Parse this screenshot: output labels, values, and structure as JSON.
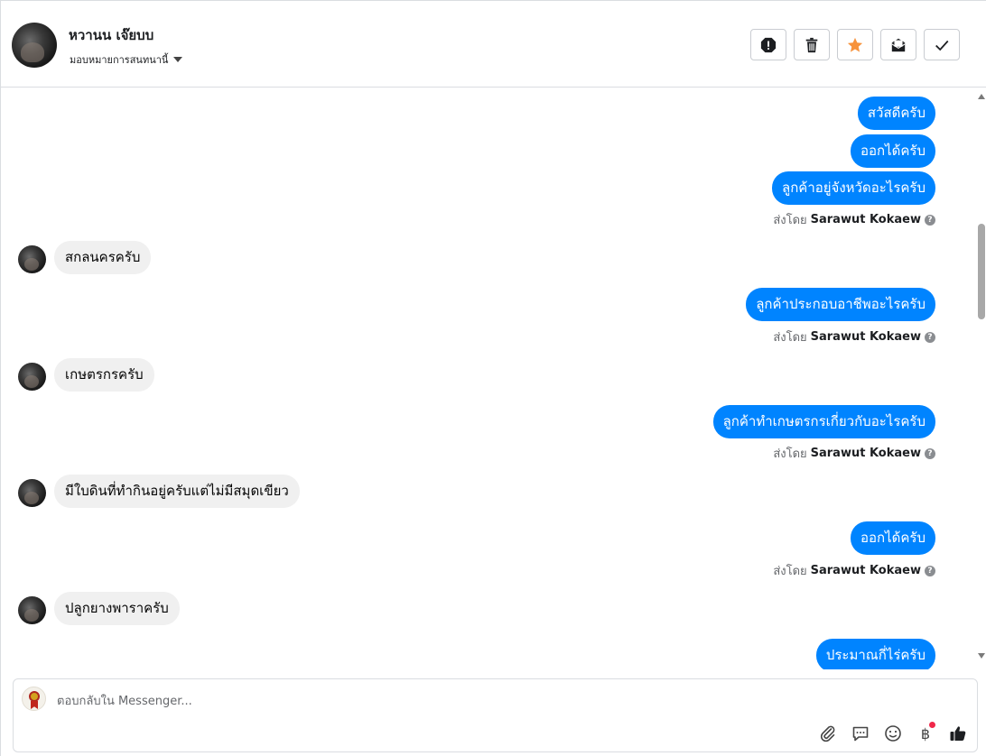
{
  "header": {
    "contact_name": "หวานน เจ๊ยบบ",
    "assign_label": "มอบหมายการสนทนานี้",
    "actions": [
      {
        "name": "report-button",
        "icon": "exclamation-circle-icon"
      },
      {
        "name": "delete-button",
        "icon": "trash-icon"
      },
      {
        "name": "star-button",
        "icon": "star-icon",
        "color": "#f7923a"
      },
      {
        "name": "mark-unread-button",
        "icon": "envelope-icon"
      },
      {
        "name": "mark-done-button",
        "icon": "check-icon"
      }
    ]
  },
  "messages": [
    {
      "dir": "out",
      "text": "สวัสดีครับ"
    },
    {
      "dir": "out",
      "text": "ออกได้ครับ"
    },
    {
      "dir": "out",
      "text": "ลูกค้าอยู่จังหวัดอะไรครับ"
    },
    {
      "dir": "sent_by",
      "prefix": "ส่งโดย",
      "name": "Sarawut Kokaew"
    },
    {
      "dir": "in",
      "text": "สกลนครครับ"
    },
    {
      "dir": "out",
      "text": "ลูกค้าประกอบอาชีพอะไรครับ"
    },
    {
      "dir": "sent_by",
      "prefix": "ส่งโดย",
      "name": "Sarawut Kokaew"
    },
    {
      "dir": "in",
      "text": "เกษตรกรครับ"
    },
    {
      "dir": "out",
      "text": "ลูกค้าทำเกษตรกรเกี่ยวกับอะไรครับ"
    },
    {
      "dir": "sent_by",
      "prefix": "ส่งโดย",
      "name": "Sarawut Kokaew"
    },
    {
      "dir": "in",
      "text": "มีใบดินที่ทำกินอยู่ครับแต่ไม่มีสมุดเขียว"
    },
    {
      "dir": "out",
      "text": "ออกได้ครับ"
    },
    {
      "dir": "sent_by",
      "prefix": "ส่งโดย",
      "name": "Sarawut Kokaew"
    },
    {
      "dir": "in",
      "text": "ปลูกยางพาราครับ"
    },
    {
      "dir": "out",
      "text": "ประมาณกี่ไร่ครับ"
    }
  ],
  "composer": {
    "placeholder": "ตอบกลับใน Messenger...",
    "value": "",
    "tools": [
      "paperclip-icon",
      "chat-bubble-icon",
      "emoji-icon",
      "baht-icon",
      "like-icon"
    ]
  },
  "colors": {
    "outgoing_bubble": "#0084ff",
    "incoming_bubble": "#f0f0f0",
    "star": "#f7923a",
    "notification_dot": "#f02849"
  }
}
